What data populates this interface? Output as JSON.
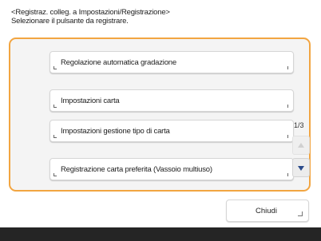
{
  "header": {
    "line1": "<Registraz. colleg. a Impostazioni/Registrazione>",
    "line2": "Selezionare il pulsante da registrare."
  },
  "items": [
    {
      "label": "Regolazione automatica gradazione"
    },
    {
      "label": "Impostazioni carta"
    },
    {
      "label": "Impostazioni gestione tipo di carta"
    },
    {
      "label": "Registrazione carta preferita (Vassoio multiuso)"
    }
  ],
  "pager": {
    "page_indicator": "1/3"
  },
  "footer": {
    "close_label": "Chiudi"
  },
  "colors": {
    "accent": "#f2a541",
    "arrow_active": "#2a4a8a",
    "bottom_bar": "#252525"
  },
  "icons": {
    "scroll_up": "triangle-up-icon",
    "scroll_down": "triangle-down-icon"
  }
}
